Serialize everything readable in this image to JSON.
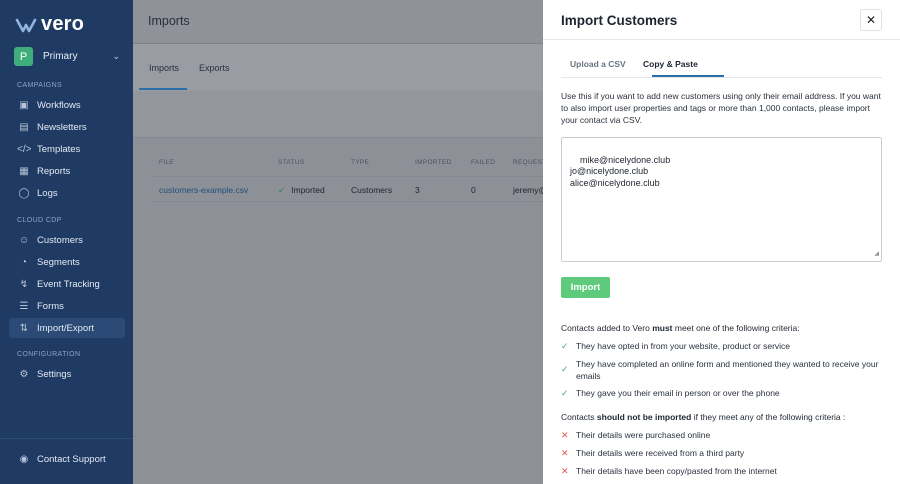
{
  "brand": {
    "name": "vero"
  },
  "workspace": {
    "initial": "P",
    "name": "Primary"
  },
  "sidebar": {
    "sections": [
      {
        "label": "CAMPAIGNS",
        "items": [
          "Workflows",
          "Newsletters",
          "Templates",
          "Reports",
          "Logs"
        ]
      },
      {
        "label": "CLOUD CDP",
        "items": [
          "Customers",
          "Segments",
          "Event Tracking",
          "Forms",
          "Import/Export"
        ]
      },
      {
        "label": "CONFIGURATION",
        "items": [
          "Settings"
        ]
      }
    ],
    "active_item": "Import/Export",
    "support_label": "Contact Support"
  },
  "main": {
    "title": "Imports",
    "tabs": [
      "Imports",
      "Exports"
    ],
    "table": {
      "headers": [
        "FILE",
        "STATUS",
        "TYPE",
        "IMPORTED",
        "FAILED",
        "REQUEST"
      ],
      "rows": [
        {
          "file": "customers-example.csv",
          "status": "Imported",
          "type": "Customers",
          "imported": "3",
          "failed": "0",
          "requested": "jeremy@"
        }
      ]
    }
  },
  "panel": {
    "title": "Import Customers",
    "tabs": [
      "Upload a CSV",
      "Copy & Paste"
    ],
    "active_tab": "Copy & Paste",
    "description": "Use this if you want to add new customers using only their email address. If you want to also import user properties and tags or more than 1,000 contacts, please import your contact via CSV.",
    "textarea_value": "mike@nicelydone.club\njo@nicelydone.club\nalice@nicelydone.club",
    "import_label": "Import",
    "must": {
      "pre": "Contacts added to Vero ",
      "bold": "must",
      "post": " meet one of the following criteria:",
      "items": [
        "They have opted in from your website, product or service",
        "They have completed an online form and mentioned they wanted to receive your emails",
        "They gave you their email in person or over the phone"
      ]
    },
    "must_not": {
      "pre": "Contacts ",
      "bold": "should not be imported",
      "post": " if they meet any of the following criteria :",
      "items": [
        "Their details were purchased online",
        "Their details were received from a third party",
        "Their details have been copy/pasted from the internet"
      ]
    }
  },
  "colors": {
    "sidebar": "#1f3b63",
    "accent": "#2c6fa8",
    "import_button": "#5dcb7b",
    "ok": "#3cae62",
    "no": "#e2574c"
  }
}
